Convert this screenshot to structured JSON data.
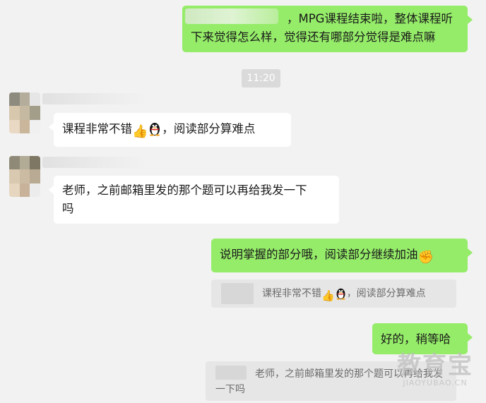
{
  "messages": {
    "m1": {
      "line1": "，MPG课程结束啦，整体课程听",
      "line2": "下来觉得怎么样，觉得还有哪部分觉得是难点嘛"
    },
    "time": "11:20",
    "m2": {
      "before": "课程非常不错",
      "after": "，阅读部分算难点"
    },
    "m3": {
      "line1": "老师，之前邮箱里发的那个题可以再给我发一下",
      "line2": "吗"
    },
    "m4": {
      "text": "说明掌握的部分哦，阅读部分继续加油"
    },
    "quote1": {
      "before": "课程非常不错",
      "after": "，阅读部分算难点"
    },
    "m5": {
      "text": "好的，稍等哈"
    },
    "quote2": {
      "line1": "老师，之前邮箱里发的那个题可以再给我发",
      "line2": "一下吗"
    }
  },
  "emojis": {
    "thumbs": "👍",
    "fist": "✊"
  },
  "watermark": {
    "cn": "教育宝",
    "en": "JIAOYUBAO.CN"
  },
  "colors": {
    "sent": "#95ec69",
    "received": "#ffffff",
    "background": "#f2f2f2"
  },
  "icons": [
    "thumbs-up-icon",
    "qq-penguin-icon",
    "fist-icon"
  ]
}
